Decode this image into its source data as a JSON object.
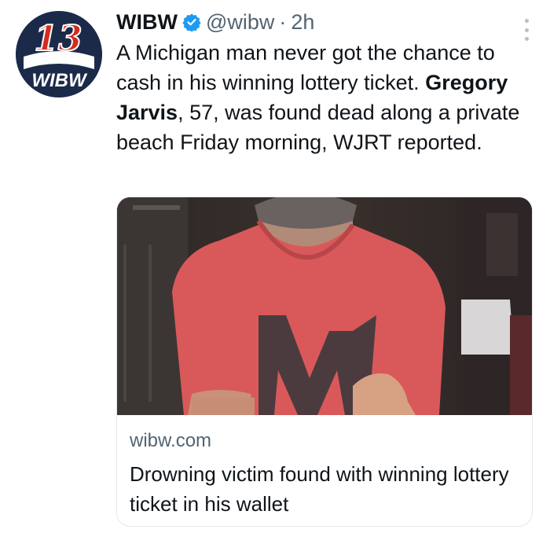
{
  "tweet": {
    "author": {
      "display_name": "WIBW",
      "handle": "@wibw",
      "verified": true,
      "avatar_icon": "wibw-13-logo",
      "avatar_text": "13 WIBW"
    },
    "separator": "·",
    "time": "2h",
    "more_icon": "more-vertical-icon",
    "text_part1": "A Michigan man never got the chance to cash in his winning lottery ticket. ",
    "text_bold": "Gregory Jarvis",
    "text_part2": ", 57, was found dead along a private beach Friday morning, WJRT reported.",
    "card": {
      "domain": "wibw.com",
      "title": "Drowning victim found with winning lottery ticket in his wallet"
    }
  },
  "colors": {
    "text": "#0f1419",
    "secondary": "#536471",
    "verified": "#1d9bf0",
    "logo_navy": "#1c2a4a",
    "logo_red": "#d52b1e"
  }
}
